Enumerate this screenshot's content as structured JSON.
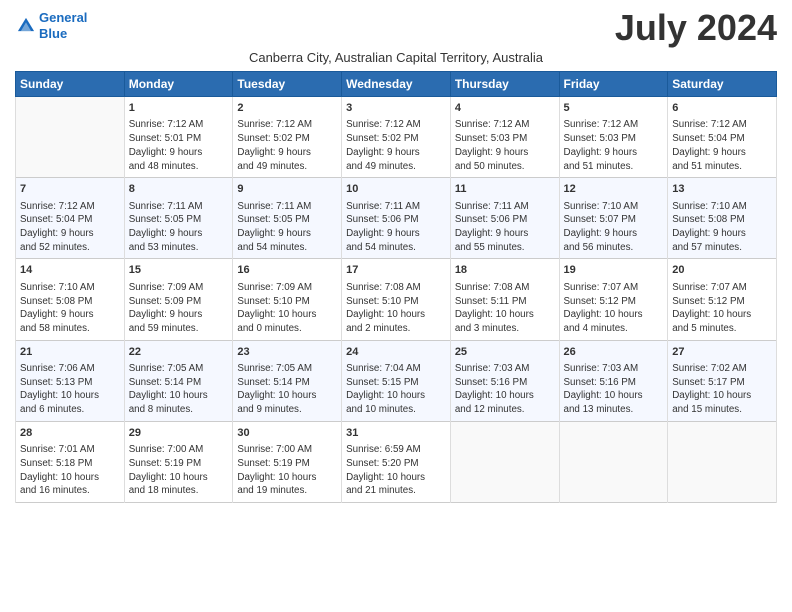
{
  "logo": {
    "line1": "General",
    "line2": "Blue"
  },
  "title": "July 2024",
  "subtitle": "Canberra City, Australian Capital Territory, Australia",
  "days_header": [
    "Sunday",
    "Monday",
    "Tuesday",
    "Wednesday",
    "Thursday",
    "Friday",
    "Saturday"
  ],
  "weeks": [
    [
      {
        "day": "",
        "info": ""
      },
      {
        "day": "1",
        "info": "Sunrise: 7:12 AM\nSunset: 5:01 PM\nDaylight: 9 hours\nand 48 minutes."
      },
      {
        "day": "2",
        "info": "Sunrise: 7:12 AM\nSunset: 5:02 PM\nDaylight: 9 hours\nand 49 minutes."
      },
      {
        "day": "3",
        "info": "Sunrise: 7:12 AM\nSunset: 5:02 PM\nDaylight: 9 hours\nand 49 minutes."
      },
      {
        "day": "4",
        "info": "Sunrise: 7:12 AM\nSunset: 5:03 PM\nDaylight: 9 hours\nand 50 minutes."
      },
      {
        "day": "5",
        "info": "Sunrise: 7:12 AM\nSunset: 5:03 PM\nDaylight: 9 hours\nand 51 minutes."
      },
      {
        "day": "6",
        "info": "Sunrise: 7:12 AM\nSunset: 5:04 PM\nDaylight: 9 hours\nand 51 minutes."
      }
    ],
    [
      {
        "day": "7",
        "info": "Sunrise: 7:12 AM\nSunset: 5:04 PM\nDaylight: 9 hours\nand 52 minutes."
      },
      {
        "day": "8",
        "info": "Sunrise: 7:11 AM\nSunset: 5:05 PM\nDaylight: 9 hours\nand 53 minutes."
      },
      {
        "day": "9",
        "info": "Sunrise: 7:11 AM\nSunset: 5:05 PM\nDaylight: 9 hours\nand 54 minutes."
      },
      {
        "day": "10",
        "info": "Sunrise: 7:11 AM\nSunset: 5:06 PM\nDaylight: 9 hours\nand 54 minutes."
      },
      {
        "day": "11",
        "info": "Sunrise: 7:11 AM\nSunset: 5:06 PM\nDaylight: 9 hours\nand 55 minutes."
      },
      {
        "day": "12",
        "info": "Sunrise: 7:10 AM\nSunset: 5:07 PM\nDaylight: 9 hours\nand 56 minutes."
      },
      {
        "day": "13",
        "info": "Sunrise: 7:10 AM\nSunset: 5:08 PM\nDaylight: 9 hours\nand 57 minutes."
      }
    ],
    [
      {
        "day": "14",
        "info": "Sunrise: 7:10 AM\nSunset: 5:08 PM\nDaylight: 9 hours\nand 58 minutes."
      },
      {
        "day": "15",
        "info": "Sunrise: 7:09 AM\nSunset: 5:09 PM\nDaylight: 9 hours\nand 59 minutes."
      },
      {
        "day": "16",
        "info": "Sunrise: 7:09 AM\nSunset: 5:10 PM\nDaylight: 10 hours\nand 0 minutes."
      },
      {
        "day": "17",
        "info": "Sunrise: 7:08 AM\nSunset: 5:10 PM\nDaylight: 10 hours\nand 2 minutes."
      },
      {
        "day": "18",
        "info": "Sunrise: 7:08 AM\nSunset: 5:11 PM\nDaylight: 10 hours\nand 3 minutes."
      },
      {
        "day": "19",
        "info": "Sunrise: 7:07 AM\nSunset: 5:12 PM\nDaylight: 10 hours\nand 4 minutes."
      },
      {
        "day": "20",
        "info": "Sunrise: 7:07 AM\nSunset: 5:12 PM\nDaylight: 10 hours\nand 5 minutes."
      }
    ],
    [
      {
        "day": "21",
        "info": "Sunrise: 7:06 AM\nSunset: 5:13 PM\nDaylight: 10 hours\nand 6 minutes."
      },
      {
        "day": "22",
        "info": "Sunrise: 7:05 AM\nSunset: 5:14 PM\nDaylight: 10 hours\nand 8 minutes."
      },
      {
        "day": "23",
        "info": "Sunrise: 7:05 AM\nSunset: 5:14 PM\nDaylight: 10 hours\nand 9 minutes."
      },
      {
        "day": "24",
        "info": "Sunrise: 7:04 AM\nSunset: 5:15 PM\nDaylight: 10 hours\nand 10 minutes."
      },
      {
        "day": "25",
        "info": "Sunrise: 7:03 AM\nSunset: 5:16 PM\nDaylight: 10 hours\nand 12 minutes."
      },
      {
        "day": "26",
        "info": "Sunrise: 7:03 AM\nSunset: 5:16 PM\nDaylight: 10 hours\nand 13 minutes."
      },
      {
        "day": "27",
        "info": "Sunrise: 7:02 AM\nSunset: 5:17 PM\nDaylight: 10 hours\nand 15 minutes."
      }
    ],
    [
      {
        "day": "28",
        "info": "Sunrise: 7:01 AM\nSunset: 5:18 PM\nDaylight: 10 hours\nand 16 minutes."
      },
      {
        "day": "29",
        "info": "Sunrise: 7:00 AM\nSunset: 5:19 PM\nDaylight: 10 hours\nand 18 minutes."
      },
      {
        "day": "30",
        "info": "Sunrise: 7:00 AM\nSunset: 5:19 PM\nDaylight: 10 hours\nand 19 minutes."
      },
      {
        "day": "31",
        "info": "Sunrise: 6:59 AM\nSunset: 5:20 PM\nDaylight: 10 hours\nand 21 minutes."
      },
      {
        "day": "",
        "info": ""
      },
      {
        "day": "",
        "info": ""
      },
      {
        "day": "",
        "info": ""
      }
    ]
  ]
}
